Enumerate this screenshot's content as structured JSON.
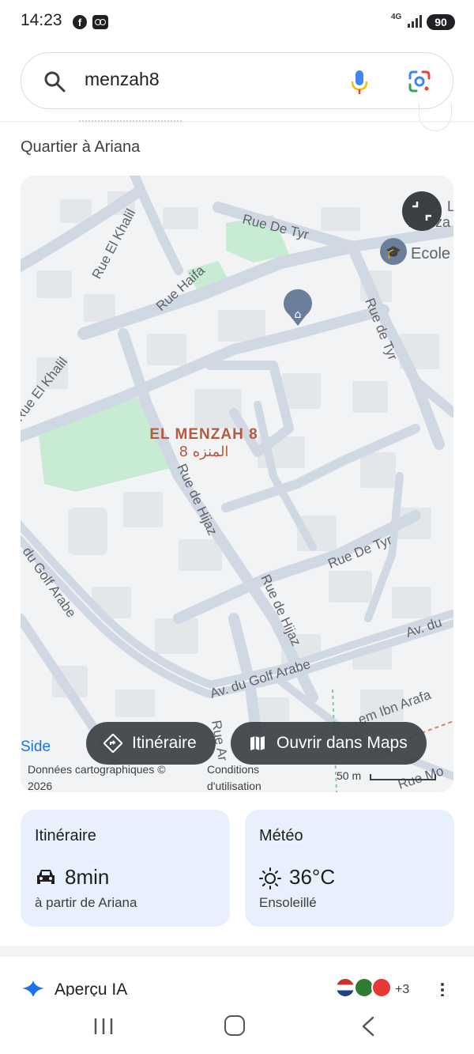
{
  "status_bar": {
    "time": "14:23",
    "network": "4G",
    "battery": "90",
    "icons": [
      "facebook-icon",
      "voicemail-icon",
      "signal-icon",
      "battery-icon"
    ]
  },
  "search": {
    "query": "menzah8",
    "icons": [
      "search-icon",
      "microphone-icon",
      "google-lens-icon"
    ]
  },
  "place": {
    "subtitle": "Quartier à Ariana"
  },
  "map": {
    "place_label_fr": "EL MENZAH 8",
    "place_label_ar": "المنزه 8",
    "poi_label_1": "L",
    "poi_label_1b": "Menza",
    "poi_label_2": "Ecole",
    "streets": {
      "rue_de_tyr_top": "Rue De Tyr",
      "rue_el_khalil_top": "Rue El Khalil",
      "rue_haifa": "Rue Haifa",
      "rue_de_tyr_right": "Rue de Tyr",
      "rue_el_khalil_left": "Rue El Khalil",
      "rue_de_hijaz_1": "Rue de Hijaz",
      "rue_de_tyr_mid": "Rue De Tyr",
      "golf_arabe_left": "du Golf Arabe",
      "rue_de_hijaz_2": "Rue de Hijaz",
      "av_du_right": "Av. du",
      "av_golf_arabe": "Av. du Golf Arabe",
      "ibn_arafa": "em Ibn Arafa",
      "rue_ar": "Rue Ar",
      "rue_mo": "Rue Mo"
    },
    "buttons": {
      "itinerary": "Itinéraire",
      "open_in_maps": "Ouvrir dans Maps"
    },
    "side_label": "Side",
    "footer": {
      "map_data": "Données cartographiques © 2026",
      "terms": "Conditions d'utilisation",
      "scale": "50 m"
    },
    "colors": {
      "land": "#f1f3f4",
      "road": "#cfd8e3",
      "park": "#c8ebd3",
      "label_brown": "#b45b3e"
    }
  },
  "cards": {
    "itinerary": {
      "title": "Itinéraire",
      "value": "8min",
      "sub": "à partir de Ariana",
      "icon": "car-icon"
    },
    "weather": {
      "title": "Météo",
      "value": "36°C",
      "sub": "Ensoleillé",
      "icon": "sun-icon"
    },
    "card_color": "#e8effd"
  },
  "ai_overview": {
    "title": "Aperçu IA",
    "extra_sources": "+3",
    "icons": [
      "ai-sparkle-icon",
      "more-vert-icon"
    ]
  },
  "nav": {
    "icons": [
      "recents-icon",
      "home-icon",
      "back-icon"
    ]
  }
}
